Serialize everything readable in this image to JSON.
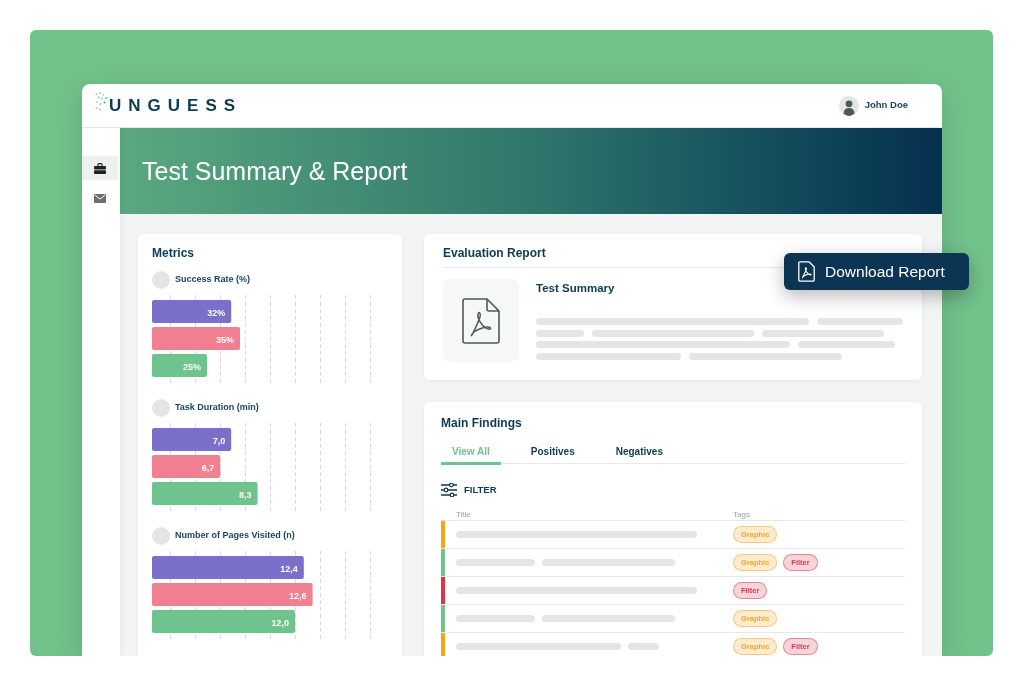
{
  "header": {
    "logo": "UNGUESS",
    "user": {
      "name": "John Doe"
    }
  },
  "sidebar": {
    "items": [
      {
        "selected": true
      },
      {
        "selected": false
      }
    ]
  },
  "banner": {
    "title": "Test Summary & Report"
  },
  "metrics": {
    "title": "Metrics",
    "items": [
      {
        "title": "Success Rate (%)",
        "bars": [
          {
            "reading": "32%",
            "color": "#7b70c9",
            "level": 0.36
          },
          {
            "reading": "35%",
            "color": "#f0808f",
            "level": 0.4
          },
          {
            "reading": "25%",
            "color": "#6ec48c",
            "level": 0.25
          }
        ]
      },
      {
        "title": "Task Duration (min)",
        "bars": [
          {
            "reading": "7,0",
            "color": "#7b70c9",
            "level": 0.36
          },
          {
            "reading": "6,7",
            "color": "#f0808f",
            "level": 0.31
          },
          {
            "reading": "8,3",
            "color": "#6ec48c",
            "level": 0.48
          }
        ]
      },
      {
        "title": "Number of Pages Visited (n)",
        "bars": [
          {
            "reading": "12,4",
            "color": "#7b70c9",
            "level": 0.69
          },
          {
            "reading": "12,6",
            "color": "#f0808f",
            "level": 0.73
          },
          {
            "reading": "12,0",
            "color": "#6ec48c",
            "level": 0.65
          }
        ]
      }
    ]
  },
  "evaluation_report": {
    "title": "Evaluation Report",
    "document": {
      "title": "Test Summary"
    },
    "download_button": "Download Report"
  },
  "main_findings": {
    "title": "Main Findings",
    "tabs": [
      {
        "label": "View All",
        "selected": true
      },
      {
        "label": "Positives",
        "selected": false
      },
      {
        "label": "Negatives",
        "selected": false
      }
    ],
    "filter": "FILTER",
    "table": {
      "columns": [
        "Title",
        "Tags"
      ],
      "rows": [
        {
          "color": "#f7a21b",
          "tags": [
            {
              "label": "Graphic",
              "color": "#f5a623"
            }
          ]
        },
        {
          "color": "#72c38c",
          "tags": [
            {
              "label": "Graphic",
              "color": "#f5a623"
            },
            {
              "label": "Filter",
              "color": "#d93a50"
            }
          ]
        },
        {
          "color": "#dc3545",
          "tags": [
            {
              "label": "Filter",
              "color": "#d93a50"
            }
          ]
        },
        {
          "color": "#72c38c",
          "tags": [
            {
              "label": "Graphic",
              "color": "#f5a623"
            }
          ]
        },
        {
          "color": "#f7a21b",
          "tags": [
            {
              "label": "Graphic",
              "color": "#f5a623"
            },
            {
              "label": "Filter",
              "color": "#d93a50"
            }
          ]
        }
      ]
    }
  }
}
